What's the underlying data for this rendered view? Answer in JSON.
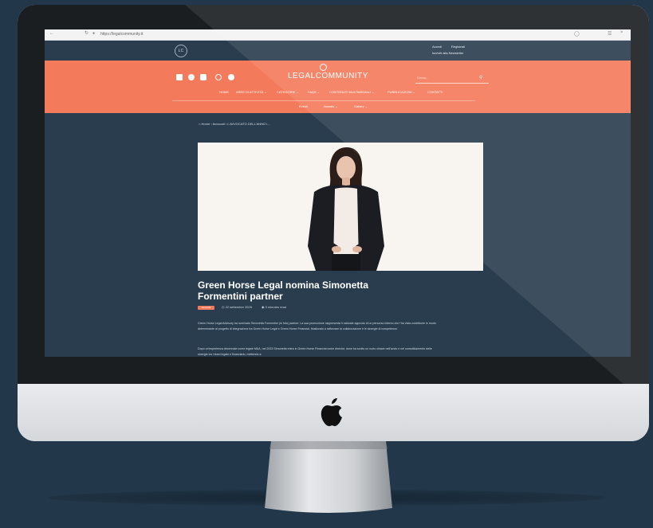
{
  "browser": {
    "url": "https://legalcommunity.it"
  },
  "site": {
    "logo_mark": "LC",
    "top_links": [
      "Accedi",
      "Registrati",
      "Iscriviti alla Newsletter"
    ],
    "brand": "LEGALCOMMUNITY",
    "search_placeholder": "Cerca...",
    "social_icons": [
      "linkedin-icon",
      "twitter-icon",
      "youtube-icon",
      "instagram-icon",
      "facebook-icon"
    ],
    "nav_row1": [
      "HOME",
      "AREE DI ATTIVITÀ ⌄",
      "CATEGORIE ⌄",
      "FAQS ⌄",
      "CONTENUTI MULTIMEDIALI ⌄",
      "PUBBLICAZIONI ⌄",
      "CONTATTI"
    ],
    "nav_row2": [
      "Eventi",
      "Awards ⌄",
      "Gallery ⌄"
    ]
  },
  "breadcrumb": [
    "Home",
    "Avvocati",
    "L'AVVOCATO DELL'ANNO I..."
  ],
  "article": {
    "title": "Green Horse Legal nomina Simonetta Formentini partner",
    "tag": "Avvocati",
    "date": "22 settembre 2025",
    "read_time": "3 minutes read",
    "paragraphs": [
      "Green Horse Legal Advisory ha nominato Simonetta Formentini (in foto) partner. La sua promozione rappresenta il naturale approdo di un percorso interno che l'ha vista contribuire in modo determinante al progetto di integrazione tra Green Horse Legal e Green Horse Financial, finalizzato a rafforzare la collaborazione e le sinergie di competenze.",
      "Dopo un'esperienza decennale come legale M&A, nel 2023 Simonetta entra in Green Horse Financial come director, dove ha svolto un ruolo chiave nell'avvio e nel consolidamento delle sinergie tra i team legale e finanziario, mettendo a"
    ]
  },
  "colors": {
    "brand_orange": "#f47a5c",
    "site_navy": "#2a3d4f",
    "page_background": "#22384a"
  }
}
